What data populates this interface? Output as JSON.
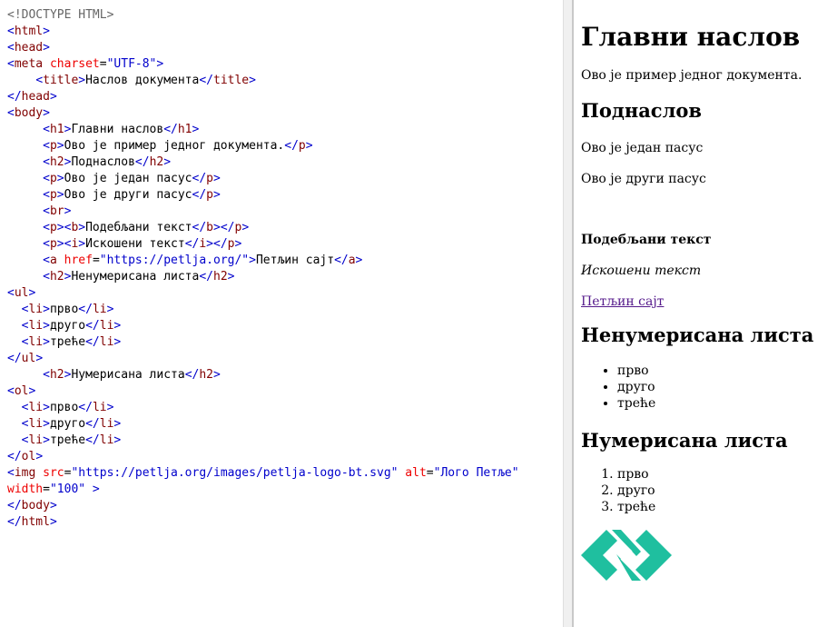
{
  "editor": {
    "lines": [
      [
        {
          "c": "d",
          "s": "<!DOCTYPE HTML>"
        }
      ],
      [
        {
          "c": "p",
          "s": "<"
        },
        {
          "c": "t",
          "s": "html"
        },
        {
          "c": "p",
          "s": ">"
        }
      ],
      [
        {
          "c": "p",
          "s": "<"
        },
        {
          "c": "t",
          "s": "head"
        },
        {
          "c": "p",
          "s": ">"
        }
      ],
      [
        {
          "c": "p",
          "s": "<"
        },
        {
          "c": "t",
          "s": "meta"
        },
        {
          "c": "a",
          "s": " charset"
        },
        {
          "c": "x",
          "s": "="
        },
        {
          "c": "v",
          "s": "\"UTF-8\""
        },
        {
          "c": "p",
          "s": ">"
        }
      ],
      [
        {
          "c": "x",
          "s": "    "
        },
        {
          "c": "p",
          "s": "<"
        },
        {
          "c": "t",
          "s": "title"
        },
        {
          "c": "p",
          "s": ">"
        },
        {
          "c": "x",
          "s": "Наслов документа"
        },
        {
          "c": "p",
          "s": "</"
        },
        {
          "c": "t",
          "s": "title"
        },
        {
          "c": "p",
          "s": ">"
        }
      ],
      [
        {
          "c": "p",
          "s": "</"
        },
        {
          "c": "t",
          "s": "head"
        },
        {
          "c": "p",
          "s": ">"
        }
      ],
      [
        {
          "c": "p",
          "s": "<"
        },
        {
          "c": "t",
          "s": "body"
        },
        {
          "c": "p",
          "s": ">"
        }
      ],
      [
        {
          "c": "x",
          "s": "     "
        },
        {
          "c": "p",
          "s": "<"
        },
        {
          "c": "t",
          "s": "h1"
        },
        {
          "c": "p",
          "s": ">"
        },
        {
          "c": "x",
          "s": "Главни наслов"
        },
        {
          "c": "p",
          "s": "</"
        },
        {
          "c": "t",
          "s": "h1"
        },
        {
          "c": "p",
          "s": ">"
        }
      ],
      [
        {
          "c": "x",
          "s": "     "
        },
        {
          "c": "p",
          "s": "<"
        },
        {
          "c": "t",
          "s": "p"
        },
        {
          "c": "p",
          "s": ">"
        },
        {
          "c": "x",
          "s": "Ово је пример једног документа."
        },
        {
          "c": "p",
          "s": "</"
        },
        {
          "c": "t",
          "s": "p"
        },
        {
          "c": "p",
          "s": ">"
        }
      ],
      [
        {
          "c": "x",
          "s": "     "
        },
        {
          "c": "p",
          "s": "<"
        },
        {
          "c": "t",
          "s": "h2"
        },
        {
          "c": "p",
          "s": ">"
        },
        {
          "c": "x",
          "s": "Поднаслов"
        },
        {
          "c": "p",
          "s": "</"
        },
        {
          "c": "t",
          "s": "h2"
        },
        {
          "c": "p",
          "s": ">"
        }
      ],
      [
        {
          "c": "x",
          "s": "     "
        },
        {
          "c": "p",
          "s": "<"
        },
        {
          "c": "t",
          "s": "p"
        },
        {
          "c": "p",
          "s": ">"
        },
        {
          "c": "x",
          "s": "Ово је један пасус"
        },
        {
          "c": "p",
          "s": "</"
        },
        {
          "c": "t",
          "s": "p"
        },
        {
          "c": "p",
          "s": ">"
        }
      ],
      [
        {
          "c": "x",
          "s": "     "
        },
        {
          "c": "p",
          "s": "<"
        },
        {
          "c": "t",
          "s": "p"
        },
        {
          "c": "p",
          "s": ">"
        },
        {
          "c": "x",
          "s": "Ово је други пасус"
        },
        {
          "c": "p",
          "s": "</"
        },
        {
          "c": "t",
          "s": "p"
        },
        {
          "c": "p",
          "s": ">"
        }
      ],
      [
        {
          "c": "x",
          "s": "     "
        },
        {
          "c": "p",
          "s": "<"
        },
        {
          "c": "t",
          "s": "br"
        },
        {
          "c": "p",
          "s": ">"
        }
      ],
      [
        {
          "c": "x",
          "s": "     "
        },
        {
          "c": "p",
          "s": "<"
        },
        {
          "c": "t",
          "s": "p"
        },
        {
          "c": "p",
          "s": "><"
        },
        {
          "c": "t",
          "s": "b"
        },
        {
          "c": "p",
          "s": ">"
        },
        {
          "c": "x",
          "s": "Подебљани текст"
        },
        {
          "c": "p",
          "s": "</"
        },
        {
          "c": "t",
          "s": "b"
        },
        {
          "c": "p",
          "s": "></"
        },
        {
          "c": "t",
          "s": "p"
        },
        {
          "c": "p",
          "s": ">"
        }
      ],
      [
        {
          "c": "x",
          "s": "     "
        },
        {
          "c": "p",
          "s": "<"
        },
        {
          "c": "t",
          "s": "p"
        },
        {
          "c": "p",
          "s": "><"
        },
        {
          "c": "t",
          "s": "i"
        },
        {
          "c": "p",
          "s": ">"
        },
        {
          "c": "x",
          "s": "Искошени текст"
        },
        {
          "c": "p",
          "s": "</"
        },
        {
          "c": "t",
          "s": "i"
        },
        {
          "c": "p",
          "s": "></"
        },
        {
          "c": "t",
          "s": "p"
        },
        {
          "c": "p",
          "s": ">"
        }
      ],
      [
        {
          "c": "x",
          "s": "     "
        },
        {
          "c": "p",
          "s": "<"
        },
        {
          "c": "t",
          "s": "a"
        },
        {
          "c": "a",
          "s": " href"
        },
        {
          "c": "x",
          "s": "="
        },
        {
          "c": "v",
          "s": "\"https://petlja.org/\""
        },
        {
          "c": "p",
          "s": ">"
        },
        {
          "c": "x",
          "s": "Петљин сајт"
        },
        {
          "c": "p",
          "s": "</"
        },
        {
          "c": "t",
          "s": "a"
        },
        {
          "c": "p",
          "s": ">"
        }
      ],
      [
        {
          "c": "x",
          "s": "     "
        },
        {
          "c": "p",
          "s": "<"
        },
        {
          "c": "t",
          "s": "h2"
        },
        {
          "c": "p",
          "s": ">"
        },
        {
          "c": "x",
          "s": "Ненумерисана листа"
        },
        {
          "c": "p",
          "s": "</"
        },
        {
          "c": "t",
          "s": "h2"
        },
        {
          "c": "p",
          "s": ">"
        }
      ],
      [
        {
          "c": "p",
          "s": "<"
        },
        {
          "c": "t",
          "s": "ul"
        },
        {
          "c": "p",
          "s": ">"
        }
      ],
      [
        {
          "c": "x",
          "s": "  "
        },
        {
          "c": "p",
          "s": "<"
        },
        {
          "c": "t",
          "s": "li"
        },
        {
          "c": "p",
          "s": ">"
        },
        {
          "c": "x",
          "s": "прво"
        },
        {
          "c": "p",
          "s": "</"
        },
        {
          "c": "t",
          "s": "li"
        },
        {
          "c": "p",
          "s": ">"
        }
      ],
      [
        {
          "c": "x",
          "s": "  "
        },
        {
          "c": "p",
          "s": "<"
        },
        {
          "c": "t",
          "s": "li"
        },
        {
          "c": "p",
          "s": ">"
        },
        {
          "c": "x",
          "s": "друго"
        },
        {
          "c": "p",
          "s": "</"
        },
        {
          "c": "t",
          "s": "li"
        },
        {
          "c": "p",
          "s": ">"
        }
      ],
      [
        {
          "c": "x",
          "s": "  "
        },
        {
          "c": "p",
          "s": "<"
        },
        {
          "c": "t",
          "s": "li"
        },
        {
          "c": "p",
          "s": ">"
        },
        {
          "c": "x",
          "s": "треће"
        },
        {
          "c": "p",
          "s": "</"
        },
        {
          "c": "t",
          "s": "li"
        },
        {
          "c": "p",
          "s": ">"
        }
      ],
      [
        {
          "c": "p",
          "s": "</"
        },
        {
          "c": "t",
          "s": "ul"
        },
        {
          "c": "p",
          "s": ">"
        }
      ],
      [
        {
          "c": "x",
          "s": "     "
        },
        {
          "c": "p",
          "s": "<"
        },
        {
          "c": "t",
          "s": "h2"
        },
        {
          "c": "p",
          "s": ">"
        },
        {
          "c": "x",
          "s": "Нумерисана листа"
        },
        {
          "c": "p",
          "s": "</"
        },
        {
          "c": "t",
          "s": "h2"
        },
        {
          "c": "p",
          "s": ">"
        }
      ],
      [
        {
          "c": "p",
          "s": "<"
        },
        {
          "c": "t",
          "s": "ol"
        },
        {
          "c": "p",
          "s": ">"
        }
      ],
      [
        {
          "c": "x",
          "s": "  "
        },
        {
          "c": "p",
          "s": "<"
        },
        {
          "c": "t",
          "s": "li"
        },
        {
          "c": "p",
          "s": ">"
        },
        {
          "c": "x",
          "s": "прво"
        },
        {
          "c": "p",
          "s": "</"
        },
        {
          "c": "t",
          "s": "li"
        },
        {
          "c": "p",
          "s": ">"
        }
      ],
      [
        {
          "c": "x",
          "s": "  "
        },
        {
          "c": "p",
          "s": "<"
        },
        {
          "c": "t",
          "s": "li"
        },
        {
          "c": "p",
          "s": ">"
        },
        {
          "c": "x",
          "s": "друго"
        },
        {
          "c": "p",
          "s": "</"
        },
        {
          "c": "t",
          "s": "li"
        },
        {
          "c": "p",
          "s": ">"
        }
      ],
      [
        {
          "c": "x",
          "s": "  "
        },
        {
          "c": "p",
          "s": "<"
        },
        {
          "c": "t",
          "s": "li"
        },
        {
          "c": "p",
          "s": ">"
        },
        {
          "c": "x",
          "s": "треће"
        },
        {
          "c": "p",
          "s": "</"
        },
        {
          "c": "t",
          "s": "li"
        },
        {
          "c": "p",
          "s": ">"
        }
      ],
      [
        {
          "c": "p",
          "s": "</"
        },
        {
          "c": "t",
          "s": "ol"
        },
        {
          "c": "p",
          "s": ">"
        }
      ],
      [
        {
          "c": "p",
          "s": "<"
        },
        {
          "c": "t",
          "s": "img"
        },
        {
          "c": "a",
          "s": " src"
        },
        {
          "c": "x",
          "s": "="
        },
        {
          "c": "v",
          "s": "\"https://petlja.org/images/petlja-logo-bt.svg\""
        },
        {
          "c": "a",
          "s": " alt"
        },
        {
          "c": "x",
          "s": "="
        },
        {
          "c": "v",
          "s": "\"Лого Петље\""
        }
      ],
      [
        {
          "c": "a",
          "s": "width"
        },
        {
          "c": "x",
          "s": "="
        },
        {
          "c": "v",
          "s": "\"100\""
        },
        {
          "c": "p",
          "s": " >"
        }
      ],
      [
        {
          "c": "p",
          "s": "</"
        },
        {
          "c": "t",
          "s": "body"
        },
        {
          "c": "p",
          "s": ">"
        }
      ],
      [
        {
          "c": "p",
          "s": "</"
        },
        {
          "c": "t",
          "s": "html"
        },
        {
          "c": "p",
          "s": ">"
        }
      ]
    ]
  },
  "preview": {
    "h1": "Главни наслов",
    "intro": "Ово је пример једног документа.",
    "subtitle": "Поднаслов",
    "para1": "Ово је један пасус",
    "para2": "Ово је други пасус",
    "bold": "Подебљани текст",
    "italic": "Искошени текст",
    "link": "Петљин сајт",
    "link_href": "https://petlja.org/",
    "ul_heading": "Ненумерисана листа",
    "ul_items": [
      "прво",
      "друго",
      "треће"
    ],
    "ol_heading": "Нумерисана листа",
    "ol_items": [
      "прво",
      "друго",
      "треће"
    ],
    "logo_alt": "Лого Петље",
    "logo_color": "#1fbf9f"
  }
}
